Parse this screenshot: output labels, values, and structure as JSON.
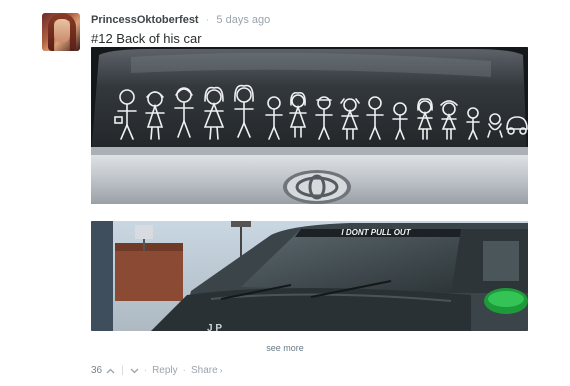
{
  "comment": {
    "username": "PrincessOktoberfest",
    "separator": "·",
    "timestamp": "5 days ago",
    "text": "#12 Back of his car"
  },
  "photos": [
    {
      "caption": ""
    },
    {
      "windshield_text": "I DONT PULL OUT",
      "plate_text": "J P"
    }
  ],
  "see_more_label": "see more",
  "footer": {
    "vote_count": "36",
    "upvote_icon": "chevron-up-icon",
    "downvote_icon": "chevron-down-icon",
    "reply_label": "Reply",
    "share_label": "Share",
    "share_chevron": "›",
    "dot": "·"
  },
  "colors": {
    "username": "#3f4548",
    "muted": "#9aa4ad",
    "link": "#687a86",
    "car_silver": "#c9cdd2",
    "truck_green": "#1d9b3a"
  }
}
